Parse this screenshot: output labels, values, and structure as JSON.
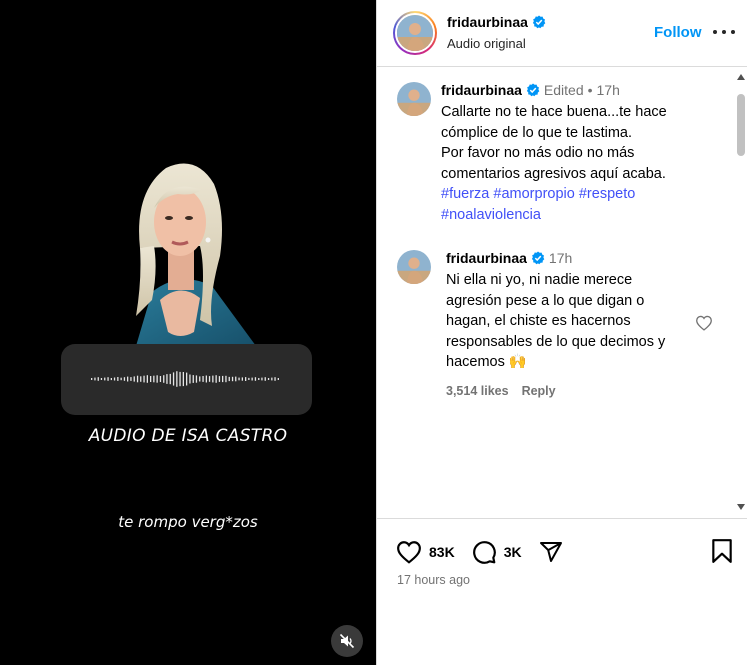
{
  "reel": {
    "audio_caption": "AUDIO DE ISA CASTRO",
    "subtitle": "te rompo verg*zos",
    "mute_icon": "speaker-muted-icon"
  },
  "header": {
    "username": "fridaurbinaa",
    "audio_label": "Audio original",
    "follow_label": "Follow",
    "more_icon": "more-horizontal-icon"
  },
  "caption": {
    "username": "fridaurbinaa",
    "edited": "Edited",
    "separator": "•",
    "time": "17h",
    "text_lines": [
      "Callarte no te hace buena...te hace",
      "cómplice de lo que te lastima.",
      "Por favor no más odio no más",
      "comentarios agresivos aquí acaba."
    ],
    "hashtags": [
      "#fuerza",
      "#amorpropio",
      "#respeto",
      "#noalaviolencia"
    ]
  },
  "comment": {
    "username": "fridaurbinaa",
    "time": "17h",
    "text_lines": [
      "Ni ella ni yo, ni nadie merece",
      "agresión pese a lo que digan o",
      "hagan, el chiste es hacernos",
      "responsables de lo que decimos y",
      "hacemos 🙌"
    ],
    "likes": "3,514 likes",
    "reply_label": "Reply"
  },
  "footer": {
    "like_count": "83K",
    "comment_count": "3K",
    "time_ago": "17 hours ago"
  },
  "colors": {
    "follow": "#0095f6",
    "hashtag": "#4150f7",
    "verified": "#0095f6",
    "muted_text": "#737373"
  }
}
